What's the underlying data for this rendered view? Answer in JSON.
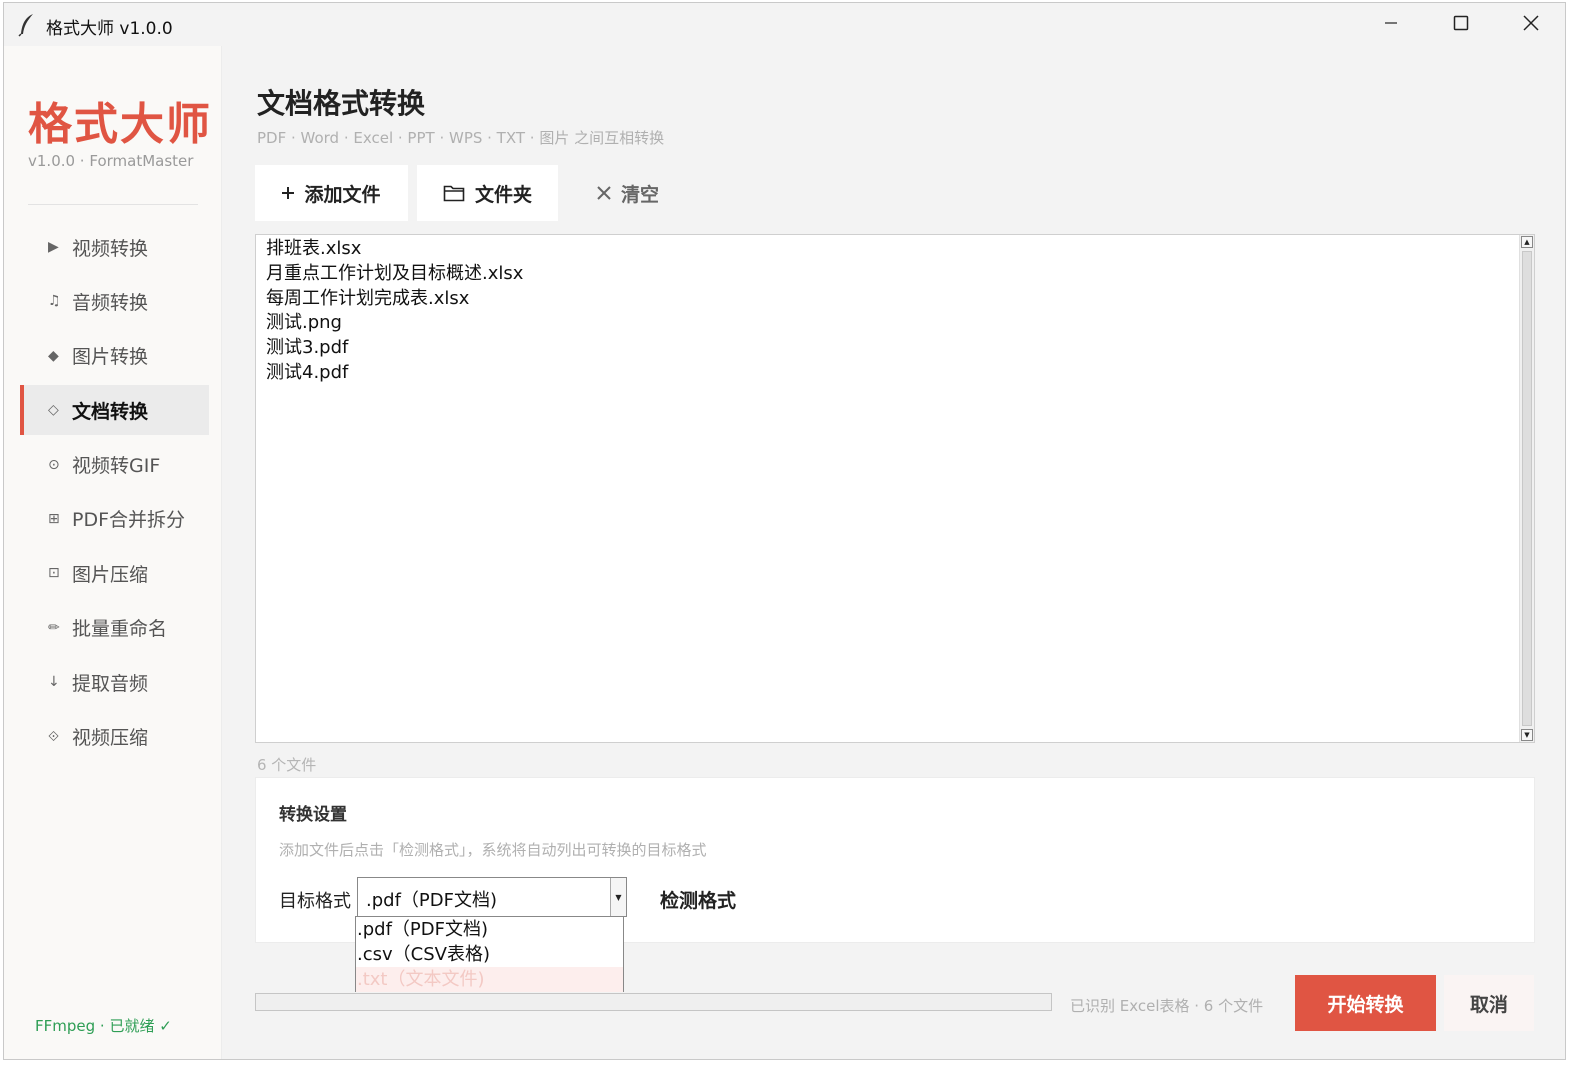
{
  "window": {
    "title": "格式大师 v1.0.0"
  },
  "sidebar": {
    "brand": "格式大师",
    "version": "v1.0.0 · FormatMaster",
    "items": [
      {
        "icon": "▶",
        "icon_name": "play-icon",
        "label": "视频转换",
        "active": false
      },
      {
        "icon": "♫",
        "icon_name": "music-note-icon",
        "label": "音频转换",
        "active": false
      },
      {
        "icon": "◆",
        "icon_name": "diamond-icon",
        "label": "图片转换",
        "active": false
      },
      {
        "icon": "◇",
        "icon_name": "diamond-outline-icon",
        "label": "文档转换",
        "active": true
      },
      {
        "icon": "⊙",
        "icon_name": "circle-dot-icon",
        "label": "视频转GIF",
        "active": false
      },
      {
        "icon": "⊞",
        "icon_name": "grid-square-icon",
        "label": "PDF合并拆分",
        "active": false
      },
      {
        "icon": "⊡",
        "icon_name": "square-dot-icon",
        "label": "图片压缩",
        "active": false
      },
      {
        "icon": "✏",
        "icon_name": "pencil-icon",
        "label": "批量重命名",
        "active": false
      },
      {
        "icon": "↓",
        "icon_name": "arrow-down-icon",
        "label": "提取音频",
        "active": false
      },
      {
        "icon": "⟐",
        "icon_name": "diamond-dot-icon",
        "label": "视频压缩",
        "active": false
      }
    ],
    "status": "FFmpeg · 已就绪 ✓"
  },
  "main": {
    "title": "文档格式转换",
    "subtitle": "PDF · Word · Excel · PPT · WPS · TXT · 图片 之间互相转换",
    "toolbar": {
      "add_label": "添加文件",
      "folder_label": "文件夹",
      "clear_label": "清空"
    },
    "files": [
      "排班表.xlsx",
      "月重点工作计划及目标概述.xlsx",
      "每周工作计划完成表.xlsx",
      "测试.png",
      "测试3.pdf",
      "测试4.pdf"
    ],
    "file_count": "6 个文件",
    "settings": {
      "title": "转换设置",
      "hint": "添加文件后点击「检测格式」，系统将自动列出可转换的目标格式",
      "target_label": "目标格式",
      "selected": ".pdf（PDF文档)",
      "detect_label": "检测格式",
      "options": [
        ".pdf（PDF文档)",
        ".csv（CSV表格)",
        ".txt（文本文件)"
      ],
      "highlighted_option": 2
    },
    "progress": {
      "value": 0,
      "text": "已识别 Excel表格 · 6 个文件"
    },
    "start_label": "开始转换",
    "cancel_label": "取消"
  },
  "colors": {
    "accent": "#e05543",
    "status_green": "#2e9e55",
    "muted_text": "#b0b0b0"
  }
}
